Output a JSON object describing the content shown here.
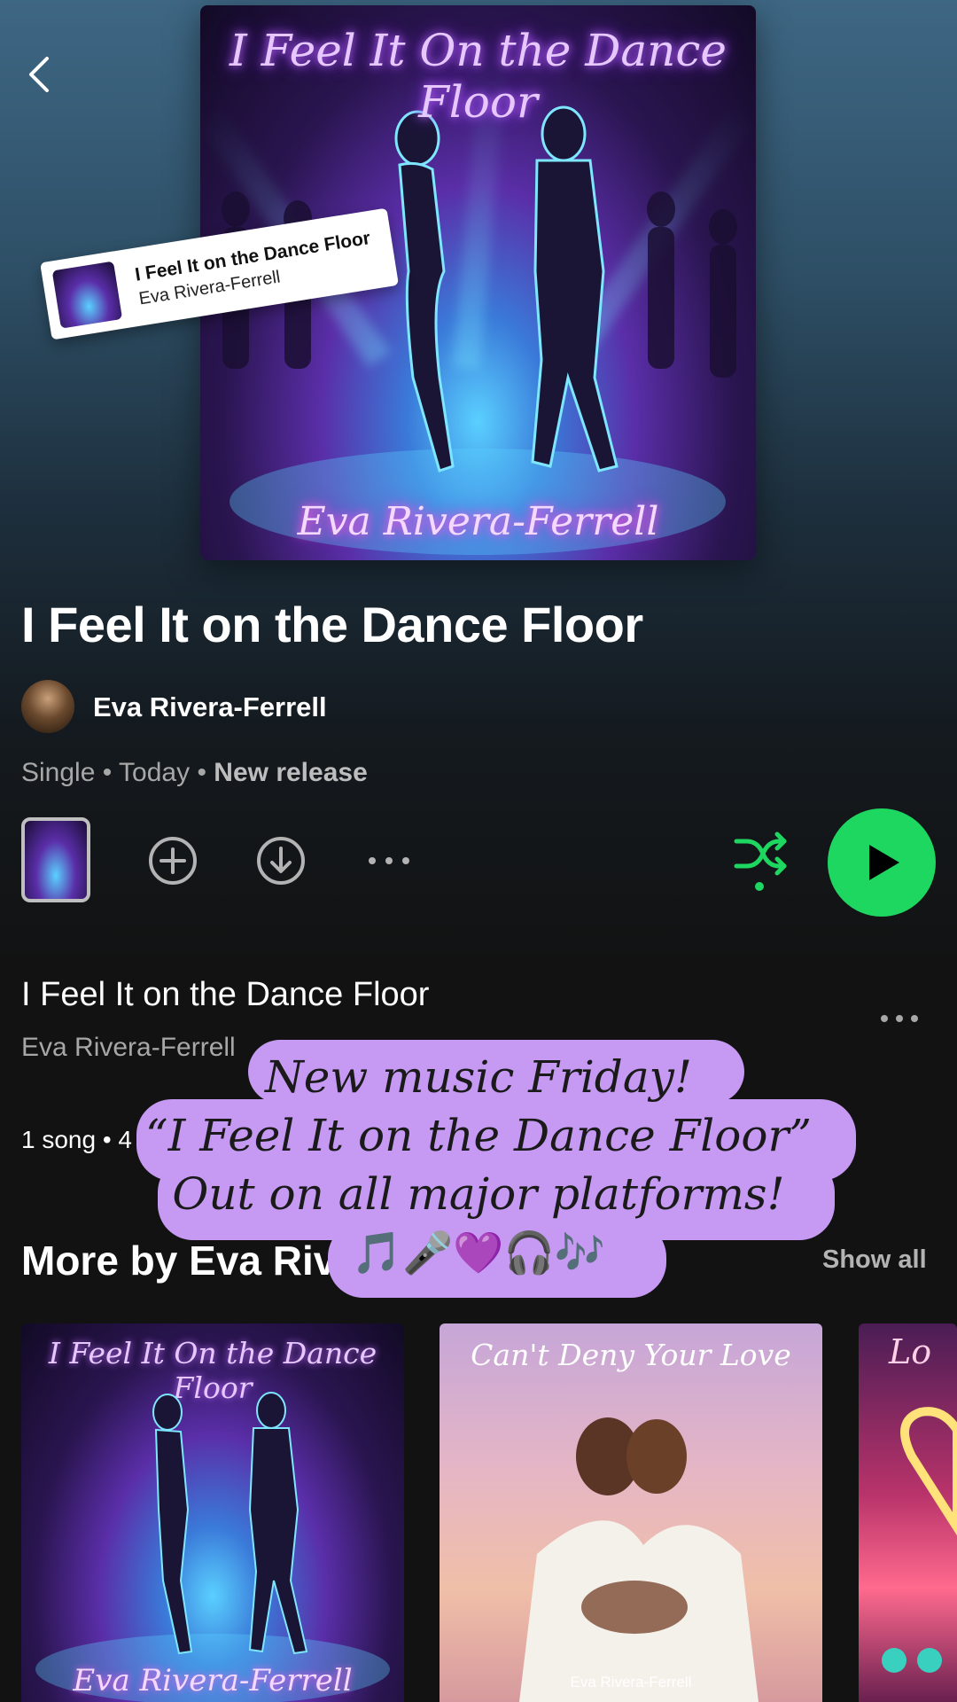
{
  "album": {
    "cover_title": "I Feel It On the Dance Floor",
    "cover_artist": "Eva Rivera-Ferrell",
    "title": "I Feel It on the Dance Floor",
    "artist": "Eva Rivera-Ferrell",
    "type": "Single",
    "date": "Today",
    "tag": "New release"
  },
  "sticker": {
    "title": "I Feel It on the Dance Floor",
    "artist": "Eva Rivera-Ferrell"
  },
  "actions": {
    "back_icon": "chevron-left-icon",
    "add_icon": "plus-circle-icon",
    "download_icon": "download-icon",
    "more_icon": "more-horizontal-icon",
    "shuffle_icon": "shuffle-icon",
    "play_icon": "play-icon",
    "accent": "#1ed760"
  },
  "track": {
    "title": "I Feel It on the Dance Floor",
    "artist": "Eva Rivera-Ferrell",
    "summary_prefix": "1 song • 4"
  },
  "more_by": {
    "title": "More by Eva Riv",
    "show_all": "Show all",
    "cards": [
      {
        "title": "I Feel It On the Dance Floor",
        "artist": "Eva Rivera-Ferrell"
      },
      {
        "title": "Can't Deny Your Love",
        "artist": "Eva Rivera-Ferrell"
      },
      {
        "title": "Lo",
        "artist": ""
      }
    ]
  },
  "overlay": {
    "line1": "New music Friday!",
    "line2": "“I Feel It on the Dance Floor”",
    "line3": "Out on all major platforms!",
    "line4": "🎵🎤💜🎧🎶",
    "color": "#c69af3"
  }
}
